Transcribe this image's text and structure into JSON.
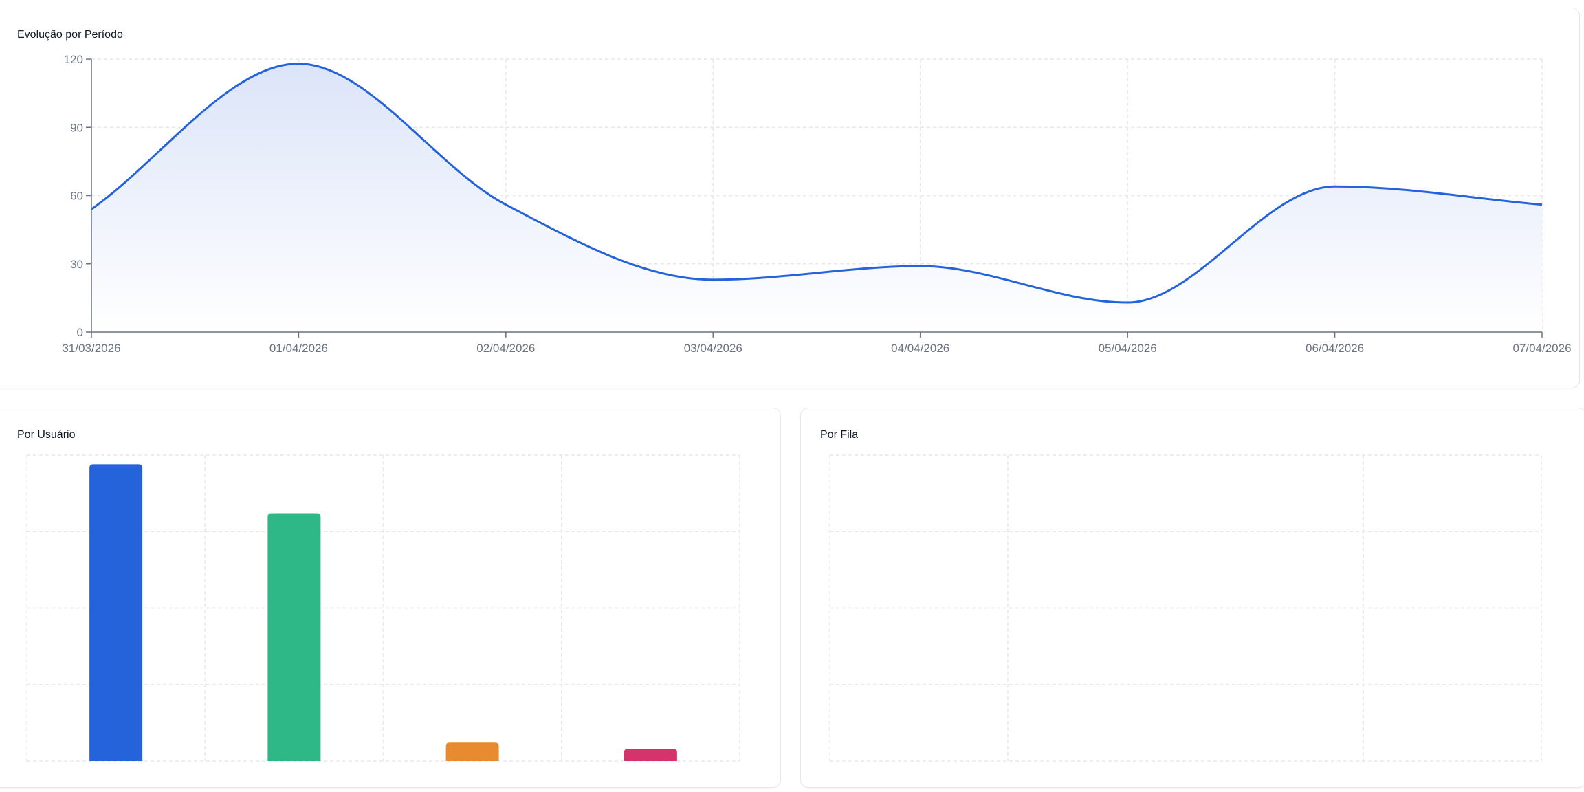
{
  "colors": {
    "line": "#2563db",
    "area_top": "#dbe4f8",
    "grid": "#e5e7eb",
    "axis": "#6b7280",
    "bar_colors": [
      "#2563db",
      "#2fb887",
      "#e88a2f",
      "#d6336c"
    ]
  },
  "chart_data": [
    {
      "type": "area",
      "title": "Evolução por Período",
      "xlabel": "",
      "ylabel": "",
      "x": [
        "31/03/2026",
        "01/04/2026",
        "02/04/2026",
        "03/04/2026",
        "04/04/2026",
        "05/04/2026",
        "06/04/2026",
        "07/04/2026"
      ],
      "values": [
        54,
        118,
        56,
        23,
        29,
        13,
        64,
        56
      ],
      "ylim": [
        0,
        120
      ],
      "yticks": [
        0,
        30,
        60,
        90,
        120
      ],
      "grid": true,
      "curve": "smooth"
    },
    {
      "type": "bar",
      "title": "Por Usuário",
      "categories": [
        "",
        "",
        "",
        ""
      ],
      "values": [
        97,
        81,
        6,
        4
      ],
      "ylim": [
        0,
        100
      ],
      "grid": true,
      "axis_labels_visible": false
    },
    {
      "type": "bar",
      "title": "Por Fila",
      "categories": [],
      "values": [],
      "grid": true
    }
  ]
}
